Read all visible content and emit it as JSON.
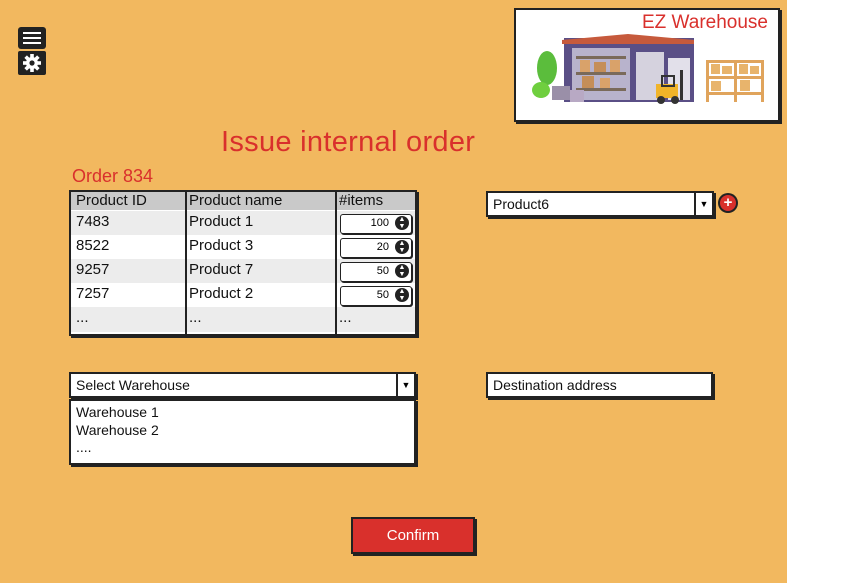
{
  "header": {
    "logo_title": "EZ Warehouse"
  },
  "page": {
    "title": "Issue internal order",
    "order_label": "Order 834"
  },
  "table": {
    "columns": [
      "Product ID",
      "Product name",
      "#items"
    ],
    "rows": [
      {
        "id": "7483",
        "name": "Product 1",
        "items": "100"
      },
      {
        "id": "8522",
        "name": "Product 3",
        "items": "20"
      },
      {
        "id": "9257",
        "name": "Product 7",
        "items": "50"
      },
      {
        "id": "7257",
        "name": "Product 2",
        "items": "50"
      }
    ],
    "more": "..."
  },
  "product_select": {
    "value": "Product6"
  },
  "warehouse_select": {
    "value": "Select Warehouse",
    "options": [
      "Warehouse 1",
      "Warehouse 2",
      "...."
    ]
  },
  "destination": {
    "placeholder": "Destination address"
  },
  "confirm": {
    "label": "Confirm"
  },
  "colors": {
    "background": "#f2b85f",
    "accent": "#d9302c",
    "header_gray": "#c9c9c9"
  }
}
